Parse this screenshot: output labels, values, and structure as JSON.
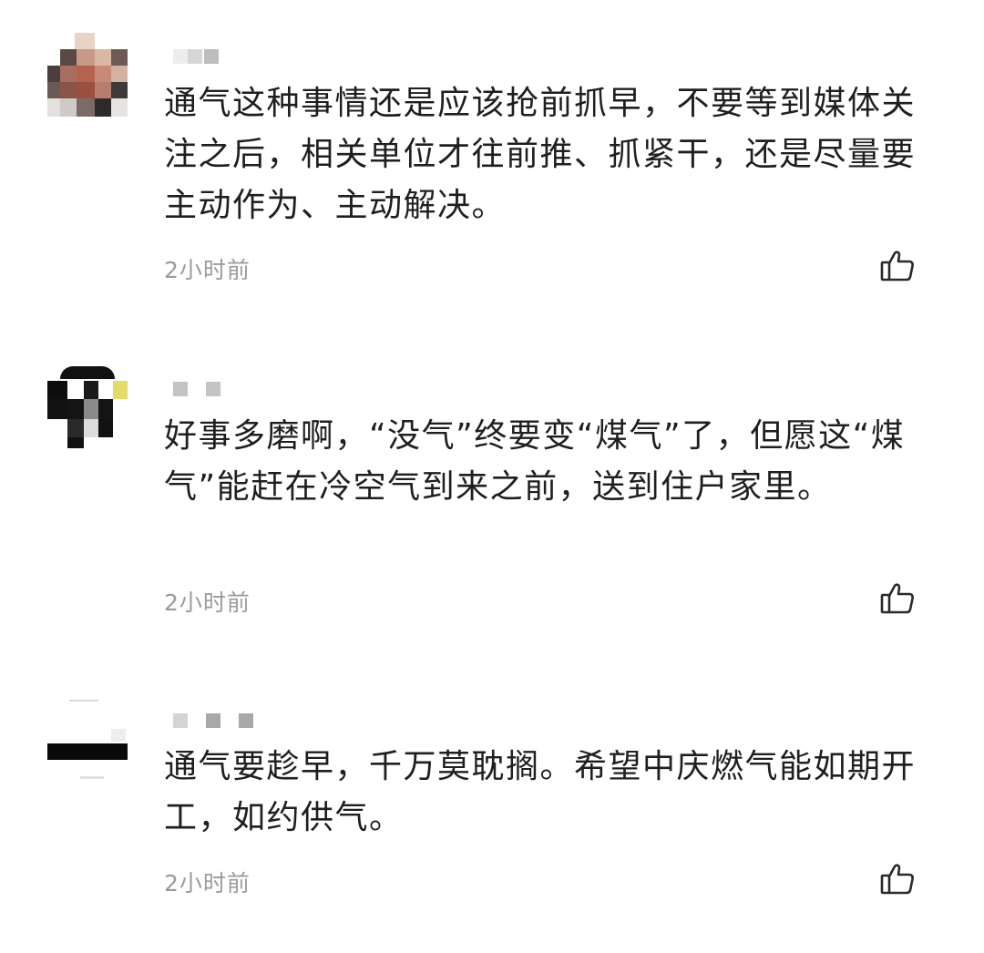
{
  "comments": [
    {
      "text": "通气这种事情还是应该抢前抓早，不要等到媒体关注之后，相关单位才往前推、抓紧干，还是尽量要主动作为、主动解决。",
      "time": "2小时前",
      "like_icon": "thumbs-up-icon"
    },
    {
      "text": "好事多磨啊，“没气”终要变“煤气”了，但愿这“煤气”能赶在冷空气到来之前，送到住户家里。",
      "time": "2小时前",
      "like_icon": "thumbs-up-icon"
    },
    {
      "text": "通气要趁早，千万莫耽搁。希望中庆燃气能如期开工，如约供气。",
      "time": "2小时前",
      "like_icon": "thumbs-up-icon"
    }
  ]
}
